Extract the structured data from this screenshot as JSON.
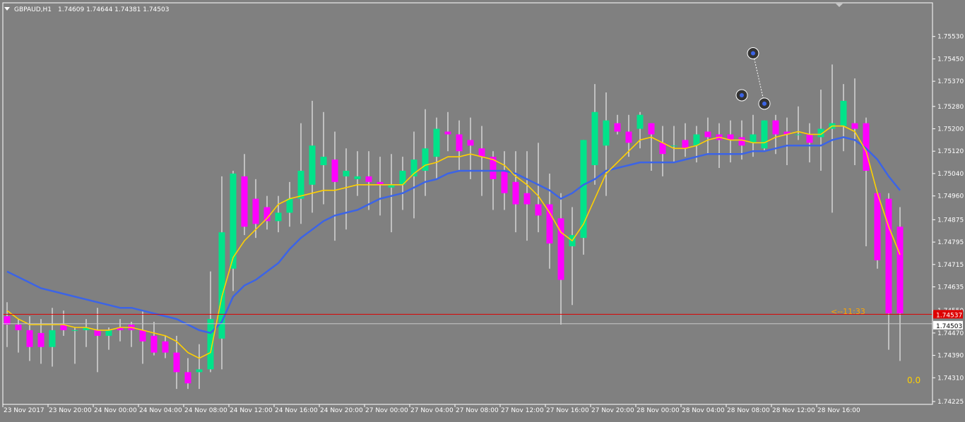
{
  "header": {
    "symbol": "GBPAUD,H1",
    "ohlc": "1.74609 1.74644 1.74381 1.74503"
  },
  "overlay": {
    "countdown": "<--11:33",
    "indicator_value": "0.0"
  },
  "colors": {
    "background": "#808080",
    "bull_candle": "#00E38A",
    "bear_candle": "#FF00FF",
    "wick": "#FFFFFF",
    "ma_fast": "#FFD000",
    "ma_slow": "#3C64E6",
    "bid_line": "#DD0000",
    "ask_line": "#C8C8C8",
    "countdown_text": "#FFA500",
    "indicator_text": "#FFD000"
  },
  "chart_data": {
    "type": "candlestick",
    "symbol": "GBPAUD",
    "timeframe": "H1",
    "ylim": [
      1.74225,
      1.7561
    ],
    "price_ticks": [
      "1.75530",
      "1.75450",
      "1.75370",
      "1.75280",
      "1.75200",
      "1.75120",
      "1.75040",
      "1.74960",
      "1.74875",
      "1.74795",
      "1.74715",
      "1.74635",
      "1.74550",
      "1.74470",
      "1.74390",
      "1.74310",
      "1.74225"
    ],
    "time_labels": [
      "23 Nov 2017",
      "23 Nov 20:00",
      "24 Nov 00:00",
      "24 Nov 04:00",
      "24 Nov 08:00",
      "24 Nov 12:00",
      "24 Nov 16:00",
      "24 Nov 20:00",
      "27 Nov 00:00",
      "27 Nov 04:00",
      "27 Nov 08:00",
      "27 Nov 12:00",
      "27 Nov 16:00",
      "27 Nov 20:00",
      "28 Nov 00:00",
      "28 Nov 04:00",
      "28 Nov 08:00",
      "28 Nov 12:00",
      "28 Nov 16:00"
    ],
    "bid_price": "1.74537",
    "ask_price": "1.74503",
    "candles": [
      [
        1.7453,
        1.7458,
        1.7442,
        1.745
      ],
      [
        1.745,
        1.7452,
        1.744,
        1.7448
      ],
      [
        1.7448,
        1.7453,
        1.7437,
        1.7442
      ],
      [
        1.7447,
        1.7452,
        1.7436,
        1.7442
      ],
      [
        1.7442,
        1.7456,
        1.7435,
        1.7448
      ],
      [
        1.745,
        1.7455,
        1.7446,
        1.7448
      ],
      [
        1.7448,
        1.7449,
        1.7436,
        1.7448
      ],
      [
        1.7448,
        1.7452,
        1.7442,
        1.7449
      ],
      [
        1.7448,
        1.7456,
        1.7433,
        1.7446
      ],
      [
        1.7446,
        1.7449,
        1.7441,
        1.7448
      ],
      [
        1.7449,
        1.7452,
        1.7444,
        1.7448
      ],
      [
        1.745,
        1.7451,
        1.7442,
        1.7448
      ],
      [
        1.7448,
        1.7455,
        1.7436,
        1.7444
      ],
      [
        1.7446,
        1.7451,
        1.7439,
        1.744
      ],
      [
        1.7444,
        1.7446,
        1.7438,
        1.744
      ],
      [
        1.744,
        1.7446,
        1.7427,
        1.7433
      ],
      [
        1.7433,
        1.7438,
        1.7427,
        1.7429
      ],
      [
        1.7433,
        1.7443,
        1.7427,
        1.7434
      ],
      [
        1.7434,
        1.7469,
        1.7433,
        1.7452
      ],
      [
        1.7445,
        1.7503,
        1.7434,
        1.7483
      ],
      [
        1.747,
        1.7505,
        1.7462,
        1.7504
      ],
      [
        1.7503,
        1.7511,
        1.7482,
        1.7485
      ],
      [
        1.7495,
        1.7502,
        1.7481,
        1.7486
      ],
      [
        1.7492,
        1.7496,
        1.7484,
        1.7487
      ],
      [
        1.7487,
        1.7496,
        1.7483,
        1.749
      ],
      [
        1.749,
        1.7501,
        1.7485,
        1.7495
      ],
      [
        1.7495,
        1.7522,
        1.7486,
        1.7505
      ],
      [
        1.75,
        1.753,
        1.749,
        1.7514
      ],
      [
        1.7507,
        1.7526,
        1.7493,
        1.751
      ],
      [
        1.7509,
        1.7519,
        1.748,
        1.7501
      ],
      [
        1.7503,
        1.7513,
        1.7484,
        1.7505
      ],
      [
        1.7502,
        1.7512,
        1.7496,
        1.7503
      ],
      [
        1.7503,
        1.7512,
        1.7491,
        1.7501
      ],
      [
        1.7501,
        1.751,
        1.7489,
        1.75
      ],
      [
        1.7499,
        1.7511,
        1.7483,
        1.75
      ],
      [
        1.75,
        1.751,
        1.7491,
        1.7505
      ],
      [
        1.7503,
        1.7519,
        1.7488,
        1.7509
      ],
      [
        1.7505,
        1.7527,
        1.7496,
        1.7513
      ],
      [
        1.751,
        1.7524,
        1.7502,
        1.752
      ],
      [
        1.7519,
        1.7526,
        1.7512,
        1.7518
      ],
      [
        1.7518,
        1.7523,
        1.7505,
        1.7512
      ],
      [
        1.7516,
        1.7524,
        1.7502,
        1.7514
      ],
      [
        1.7513,
        1.7521,
        1.7496,
        1.751
      ],
      [
        1.751,
        1.7512,
        1.7491,
        1.7502
      ],
      [
        1.7505,
        1.7512,
        1.7491,
        1.7497
      ],
      [
        1.7501,
        1.7512,
        1.7483,
        1.7493
      ],
      [
        1.7497,
        1.7512,
        1.748,
        1.7493
      ],
      [
        1.7493,
        1.7515,
        1.7483,
        1.7489
      ],
      [
        1.7493,
        1.7504,
        1.747,
        1.7479
      ],
      [
        1.7488,
        1.7497,
        1.745,
        1.7466
      ],
      [
        1.7478,
        1.7492,
        1.7457,
        1.7482
      ],
      [
        1.7481,
        1.7516,
        1.7475,
        1.7516
      ],
      [
        1.7507,
        1.7536,
        1.75,
        1.7526
      ],
      [
        1.7514,
        1.7533,
        1.7496,
        1.7523
      ],
      [
        1.7522,
        1.7525,
        1.7518,
        1.7519
      ],
      [
        1.7519,
        1.7525,
        1.751,
        1.7515
      ],
      [
        1.752,
        1.7526,
        1.7513,
        1.7525
      ],
      [
        1.7522,
        1.7521,
        1.7505,
        1.7518
      ],
      [
        1.7515,
        1.7521,
        1.7503,
        1.7511
      ],
      [
        1.7514,
        1.7521,
        1.7508,
        1.7514
      ],
      [
        1.7516,
        1.7522,
        1.751,
        1.7513
      ],
      [
        1.7514,
        1.7521,
        1.7508,
        1.7518
      ],
      [
        1.7519,
        1.7524,
        1.7511,
        1.7517
      ],
      [
        1.7518,
        1.7522,
        1.7506,
        1.7516
      ],
      [
        1.7518,
        1.7523,
        1.7508,
        1.7516
      ],
      [
        1.7517,
        1.7523,
        1.7509,
        1.7514
      ],
      [
        1.7515,
        1.7525,
        1.751,
        1.7518
      ],
      [
        1.7513,
        1.7523,
        1.7512,
        1.7523
      ],
      [
        1.7523,
        1.7525,
        1.7511,
        1.7518
      ],
      [
        1.7519,
        1.7524,
        1.7507,
        1.7518
      ],
      [
        1.7518,
        1.7528,
        1.7516,
        1.7518
      ],
      [
        1.7518,
        1.7522,
        1.7508,
        1.7515
      ],
      [
        1.7517,
        1.7534,
        1.7505,
        1.752
      ],
      [
        1.752,
        1.7543,
        1.749,
        1.7522
      ],
      [
        1.7521,
        1.7536,
        1.7512,
        1.753
      ],
      [
        1.7522,
        1.7538,
        1.7507,
        1.752
      ],
      [
        1.7522,
        1.7524,
        1.7478,
        1.7505
      ],
      [
        1.7497,
        1.7497,
        1.747,
        1.7473
      ],
      [
        1.7495,
        1.7497,
        1.7441,
        1.7454
      ],
      [
        1.7485,
        1.7492,
        1.7437,
        1.7454
      ]
    ],
    "ma_fast": [
      1.7455,
      1.7452,
      1.745,
      1.745,
      1.745,
      1.745,
      1.7449,
      1.7449,
      1.7448,
      1.7448,
      1.7449,
      1.7449,
      1.7448,
      1.7447,
      1.7446,
      1.7444,
      1.744,
      1.7438,
      1.744,
      1.746,
      1.7474,
      1.748,
      1.7484,
      1.7488,
      1.7493,
      1.7495,
      1.7496,
      1.7497,
      1.7498,
      1.7498,
      1.7499,
      1.75,
      1.75,
      1.75,
      1.75,
      1.75,
      1.7504,
      1.7507,
      1.7508,
      1.751,
      1.751,
      1.7511,
      1.751,
      1.7509,
      1.7507,
      1.7503,
      1.75,
      1.7496,
      1.749,
      1.7483,
      1.748,
      1.7486,
      1.7495,
      1.7504,
      1.7508,
      1.7512,
      1.7516,
      1.7517,
      1.7515,
      1.7513,
      1.7513,
      1.7514,
      1.7516,
      1.7517,
      1.7516,
      1.7516,
      1.7515,
      1.7515,
      1.7517,
      1.7518,
      1.7519,
      1.7518,
      1.7518,
      1.7521,
      1.7521,
      1.7519,
      1.7512,
      1.7497,
      1.7485,
      1.7475
    ],
    "ma_slow": [
      1.7469,
      1.7467,
      1.7465,
      1.7463,
      1.7462,
      1.7461,
      1.746,
      1.7459,
      1.7458,
      1.7457,
      1.7456,
      1.7456,
      1.7455,
      1.7454,
      1.7453,
      1.7452,
      1.745,
      1.7448,
      1.7447,
      1.7451,
      1.746,
      1.7464,
      1.7466,
      1.7469,
      1.7472,
      1.7477,
      1.7481,
      1.7484,
      1.7487,
      1.7489,
      1.749,
      1.7491,
      1.7493,
      1.7495,
      1.7496,
      1.7497,
      1.7499,
      1.7501,
      1.7502,
      1.7504,
      1.7505,
      1.7505,
      1.7505,
      1.7505,
      1.7505,
      1.7504,
      1.7502,
      1.75,
      1.7498,
      1.7495,
      1.7497,
      1.75,
      1.7502,
      1.7505,
      1.7506,
      1.7507,
      1.7508,
      1.7508,
      1.7508,
      1.7508,
      1.7509,
      1.751,
      1.7511,
      1.7511,
      1.7511,
      1.7511,
      1.7512,
      1.7512,
      1.7513,
      1.7514,
      1.7514,
      1.7514,
      1.7514,
      1.7516,
      1.7517,
      1.7516,
      1.7513,
      1.7509,
      1.7503,
      1.7498
    ],
    "arrows": [
      {
        "index": 66,
        "price": 1.7547
      },
      {
        "index": 65,
        "price": 1.7532
      },
      {
        "index": 67,
        "price": 1.7529
      }
    ]
  }
}
